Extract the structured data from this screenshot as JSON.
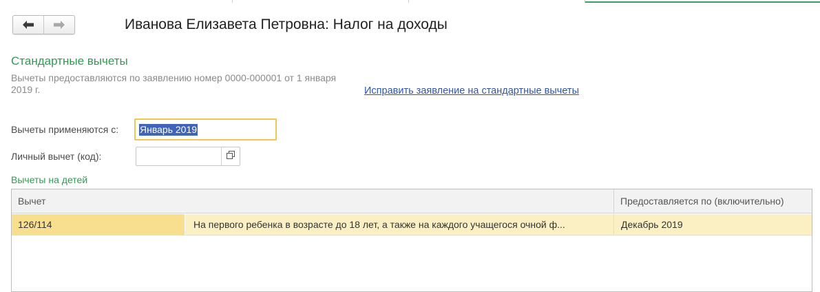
{
  "window": {
    "title": "Иванова Елизавета Петровна: Налог на доходы"
  },
  "standard": {
    "title": "Стандартные вычеты",
    "info": "Вычеты предоставляются по заявлению номер 0000-000001 от 1 января 2019 г.",
    "fix_link": "Исправить заявление на стандартные вычеты"
  },
  "fields": {
    "applied_from_label": "Вычеты применяются с:",
    "applied_from_value": "Январь 2019",
    "personal_code_label": "Личный вычет (код):",
    "personal_code_value": ""
  },
  "children": {
    "title": "Вычеты на детей",
    "columns": {
      "deduction": "Вычет",
      "provided_until": "Предоставляется по (включительно)"
    },
    "rows": [
      {
        "code": "126/114",
        "description": "На первого ребенка в возрасте до 18 лет, а также на каждого учащегося очной ф...",
        "provided_until": "Декабрь 2019"
      }
    ]
  },
  "icons": {
    "back": "arrow-left-icon",
    "forward": "arrow-right-icon",
    "open": "open-form-icon"
  },
  "colors": {
    "section_title": "#2e9b52",
    "link": "#2f56a8",
    "active_field_border": "#efc850",
    "selected_row": "#fbf0c3",
    "selected_cell": "#f7df8f",
    "text_selection": "#3f64b8"
  }
}
